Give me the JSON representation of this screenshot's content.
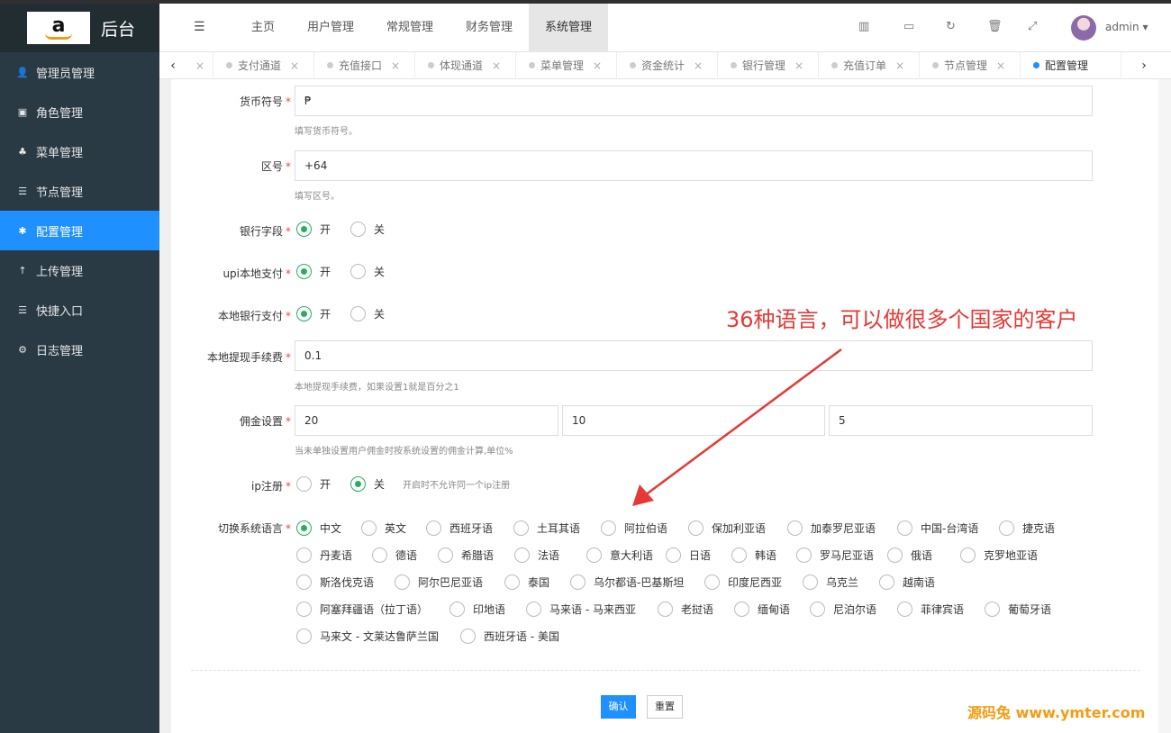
{
  "brand": {
    "logo_letter": "a",
    "title": "后台"
  },
  "sidebar": {
    "items": [
      {
        "label": "管理员管理",
        "icon": "user-icon",
        "glyph": "👤",
        "active": false
      },
      {
        "label": "角色管理",
        "icon": "id-card-icon",
        "glyph": "▣",
        "active": false
      },
      {
        "label": "菜单管理",
        "icon": "tree-icon",
        "glyph": "♣",
        "active": false
      },
      {
        "label": "节点管理",
        "icon": "list-icon",
        "glyph": "☰",
        "active": false
      },
      {
        "label": "配置管理",
        "icon": "asterisk-icon",
        "glyph": "✱",
        "active": true
      },
      {
        "label": "上传管理",
        "icon": "upload-arrow-icon",
        "glyph": "↑",
        "active": false
      },
      {
        "label": "快捷入口",
        "icon": "list-icon",
        "glyph": "☰",
        "active": false
      },
      {
        "label": "日志管理",
        "icon": "cog-icon",
        "glyph": "⚙",
        "active": false
      }
    ]
  },
  "topnav": {
    "tabs": [
      "主页",
      "用户管理",
      "常规管理",
      "财务管理",
      "系统管理"
    ],
    "active": "系统管理",
    "user": "admin"
  },
  "tabbar": {
    "tabs": [
      "支付通道",
      "充值接口",
      "体现通道",
      "菜单管理",
      "资金统计",
      "银行管理",
      "充值订单",
      "节点管理",
      "配置管理"
    ],
    "active": "配置管理"
  },
  "form": {
    "currency": {
      "label": "货币符号",
      "value": "₱",
      "hint": "填写货币符号。"
    },
    "area_code": {
      "label": "区号",
      "value": "+64",
      "hint": "填写区号。"
    },
    "bank_field": {
      "label": "银行字段",
      "on": "开",
      "off": "关",
      "selected": "on"
    },
    "upi_pay": {
      "label": "upi本地支付",
      "on": "开",
      "off": "关",
      "selected": "on"
    },
    "local_bank_pay": {
      "label": "本地银行支付",
      "on": "开",
      "off": "关",
      "selected": "on"
    },
    "withdraw_fee": {
      "label": "本地提现手续费",
      "value": "0.1",
      "hint": "本地提现手续费，如果设置1就是百分之1"
    },
    "commission": {
      "label": "佣金设置",
      "values": [
        "20",
        "10",
        "5"
      ],
      "hint": "当未单独设置用户佣金时按系统设置的佣金计算,单位%"
    },
    "ip_register": {
      "label": "ip注册",
      "on": "开",
      "off": "关",
      "selected": "off",
      "note": "开启时不允许同一个ip注册"
    },
    "language": {
      "label": "切换系统语言",
      "selected": "中文",
      "options": [
        "中文",
        "英文",
        "西班牙语",
        "土耳其语",
        "阿拉伯语",
        "保加利亚语",
        "加泰罗尼亚语",
        "中国-台湾语",
        "捷克语",
        "丹麦语",
        "德语",
        "希腊语",
        "法语",
        "意大利语",
        "日语",
        "韩语",
        "罗马尼亚语",
        "俄语",
        "克罗地亚语",
        "斯洛伐克语",
        "阿尔巴尼亚语",
        "泰国",
        "乌尔都语-巴基斯坦",
        "印度尼西亚",
        "乌克兰",
        "越南语",
        "阿塞拜疆语（拉丁语）",
        "印地语",
        "马来语 - 马来西亚",
        "老挝语",
        "缅甸语",
        "尼泊尔语",
        "菲律宾语",
        "葡萄牙语",
        "马来文 - 文莱达鲁萨兰国",
        "西班牙语 - 美国"
      ]
    },
    "submit": "确认",
    "reset": "重置"
  },
  "annotation": "36种语言，可以做很多个国家的客户",
  "watermark": "源码兔 www.ymter.com",
  "colors": {
    "sidebar": "#2a3a45",
    "accent": "#1e90ff",
    "radio_on": "#27ae60",
    "annotation": "#e53935",
    "watermark": "#f39c12"
  }
}
